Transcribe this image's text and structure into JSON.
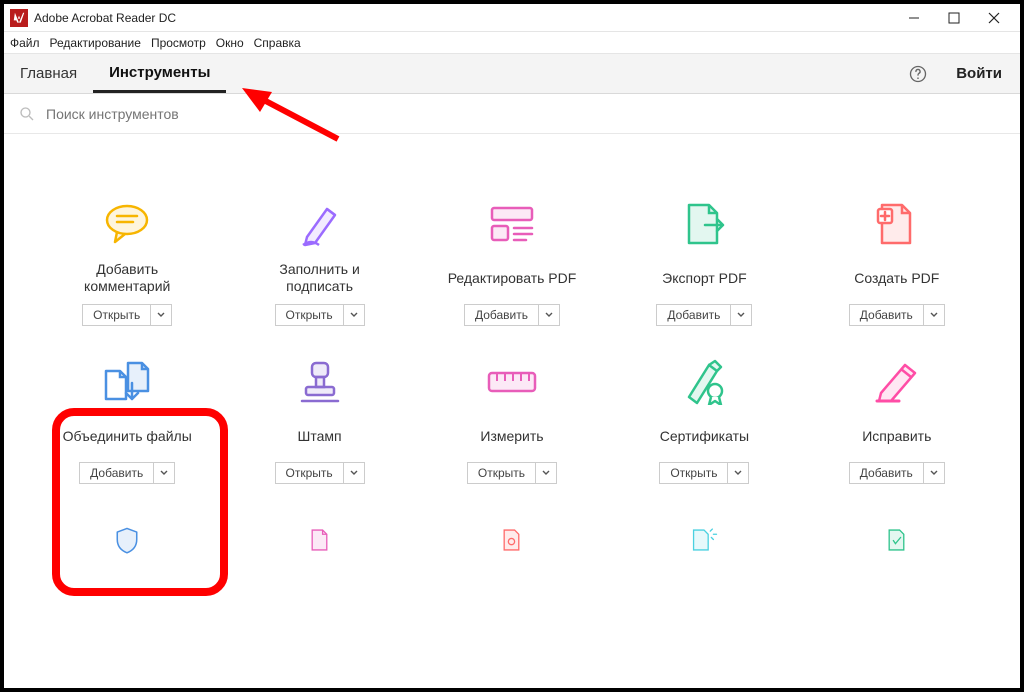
{
  "titlebar": {
    "title": "Adobe Acrobat Reader DC"
  },
  "menubar": {
    "items": [
      "Файл",
      "Редактирование",
      "Просмотр",
      "Окно",
      "Справка"
    ]
  },
  "tabs": {
    "home": "Главная",
    "tools": "Инструменты",
    "login": "Войти"
  },
  "search": {
    "placeholder": "Поиск инструментов"
  },
  "buttons": {
    "open": "Открыть",
    "add": "Добавить"
  },
  "tools": [
    {
      "label": "Добавить комментарий",
      "action": "open",
      "icon": "comment",
      "color": "#f7b500"
    },
    {
      "label": "Заполнить и подписать",
      "action": "open",
      "icon": "fillsign",
      "color": "#9b6bff"
    },
    {
      "label": "Редактировать PDF",
      "action": "add",
      "icon": "editpdf",
      "color": "#e85db9"
    },
    {
      "label": "Экспорт PDF",
      "action": "add",
      "icon": "export",
      "color": "#2fc48c"
    },
    {
      "label": "Создать PDF",
      "action": "add",
      "icon": "create",
      "color": "#ff6b6b"
    },
    {
      "label": "Объединить файлы",
      "action": "add",
      "icon": "combine",
      "color": "#4a90e2"
    },
    {
      "label": "Штамп",
      "action": "open",
      "icon": "stamp",
      "color": "#8a6bd1"
    },
    {
      "label": "Измерить",
      "action": "open",
      "icon": "measure",
      "color": "#e85db9"
    },
    {
      "label": "Сертификаты",
      "action": "open",
      "icon": "cert",
      "color": "#2fc48c"
    },
    {
      "label": "Исправить",
      "action": "add",
      "icon": "redact",
      "color": "#ff4da6"
    },
    {
      "label": "",
      "action": "",
      "icon": "protect",
      "color": "#4a90e2"
    },
    {
      "label": "",
      "action": "",
      "icon": "doc2",
      "color": "#e85db9"
    },
    {
      "label": "",
      "action": "",
      "icon": "doc3",
      "color": "#ff6b6b"
    },
    {
      "label": "",
      "action": "",
      "icon": "doc4",
      "color": "#4ad1e0"
    },
    {
      "label": "",
      "action": "",
      "icon": "doc5",
      "color": "#2fc48c"
    }
  ]
}
